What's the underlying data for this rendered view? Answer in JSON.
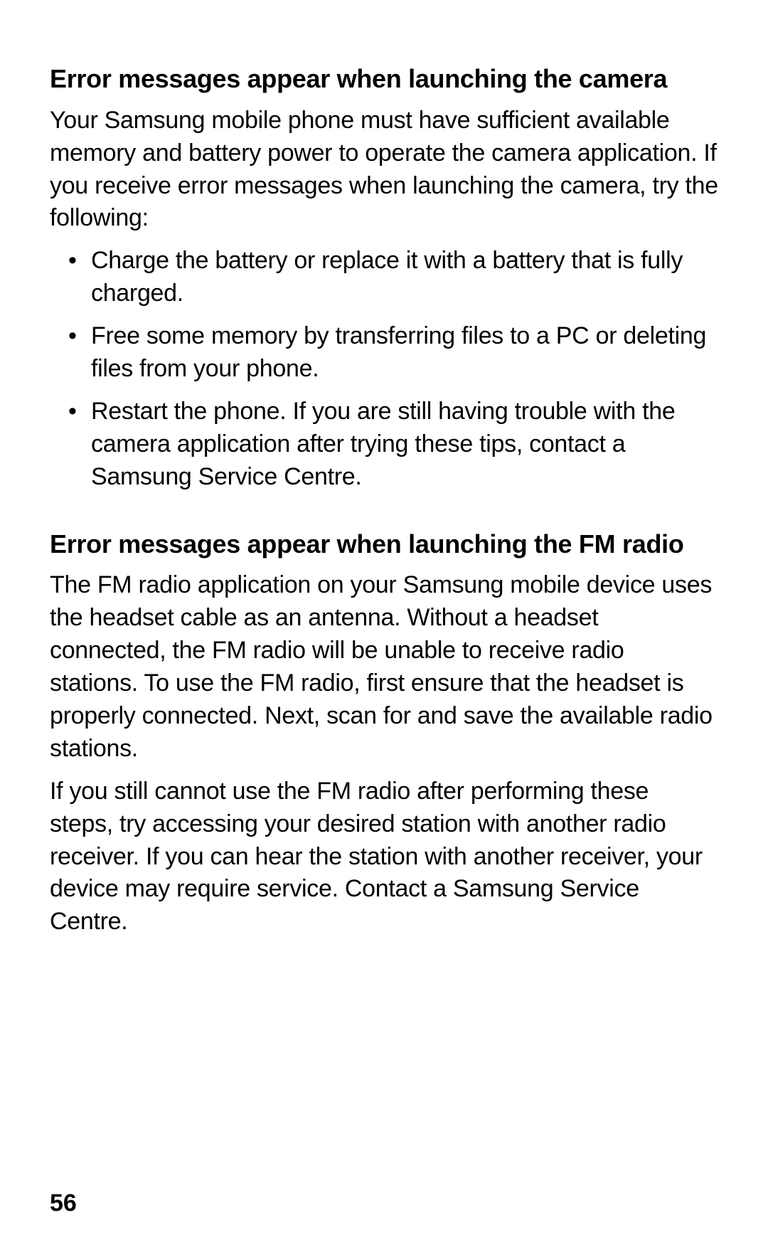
{
  "section1": {
    "heading": "Error messages appear when launching the camera",
    "intro": "Your Samsung mobile phone must have sufficient available memory and battery power to operate the camera application. If you receive error messages when launching the camera, try the following:",
    "bullets": [
      "Charge the battery or replace it with a battery that is fully charged.",
      "Free some memory by transferring files to a PC or deleting files from your phone.",
      "Restart the phone. If you are still having trouble with the camera application after trying these tips, contact a Samsung Service Centre."
    ]
  },
  "section2": {
    "heading": "Error messages appear when launching the FM radio",
    "para1": "The FM radio application on your Samsung mobile device uses the headset cable as an antenna. Without a headset connected, the FM radio will be unable to receive radio stations. To use the FM radio, first ensure that the headset is properly connected. Next, scan for and save the available radio stations.",
    "para2": "If you still cannot use the FM radio after performing these steps, try accessing your desired station with another radio receiver. If you can hear the station with another receiver, your device may require service. Contact a Samsung Service Centre."
  },
  "page_number": "56"
}
